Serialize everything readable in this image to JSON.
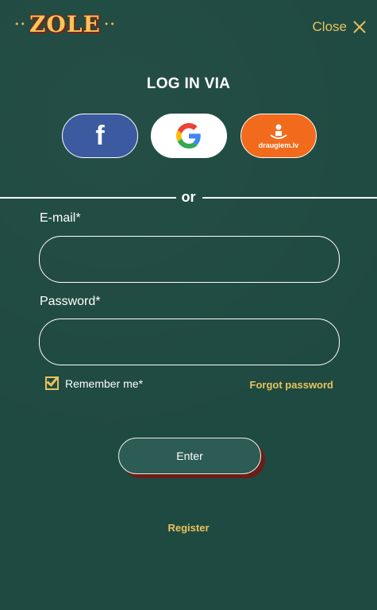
{
  "header": {
    "logo_text": "ZOLE",
    "logo_dots_left": "••",
    "logo_dots_right": "••",
    "close_label": "Close"
  },
  "login": {
    "heading": "LOG IN VIA",
    "social": [
      {
        "name": "Facebook",
        "glyph": "f",
        "color": "#3b5aa0"
      },
      {
        "name": "Google",
        "color": "#ffffff"
      },
      {
        "name": "draugiem.lv",
        "label": "draugiem.lv",
        "color": "#f26a1b"
      }
    ],
    "divider_text": "or"
  },
  "form": {
    "email_label": "E-mail*",
    "email_value": "",
    "password_label": "Password*",
    "password_value": "",
    "remember_label": "Remember me*",
    "remember_checked": true,
    "forgot_label": "Forgot password",
    "enter_label": "Enter",
    "register_label": "Register"
  },
  "colors": {
    "background": "#1f4a41",
    "accent": "#e8c35c",
    "enter_shadow": "#6b1d18"
  }
}
